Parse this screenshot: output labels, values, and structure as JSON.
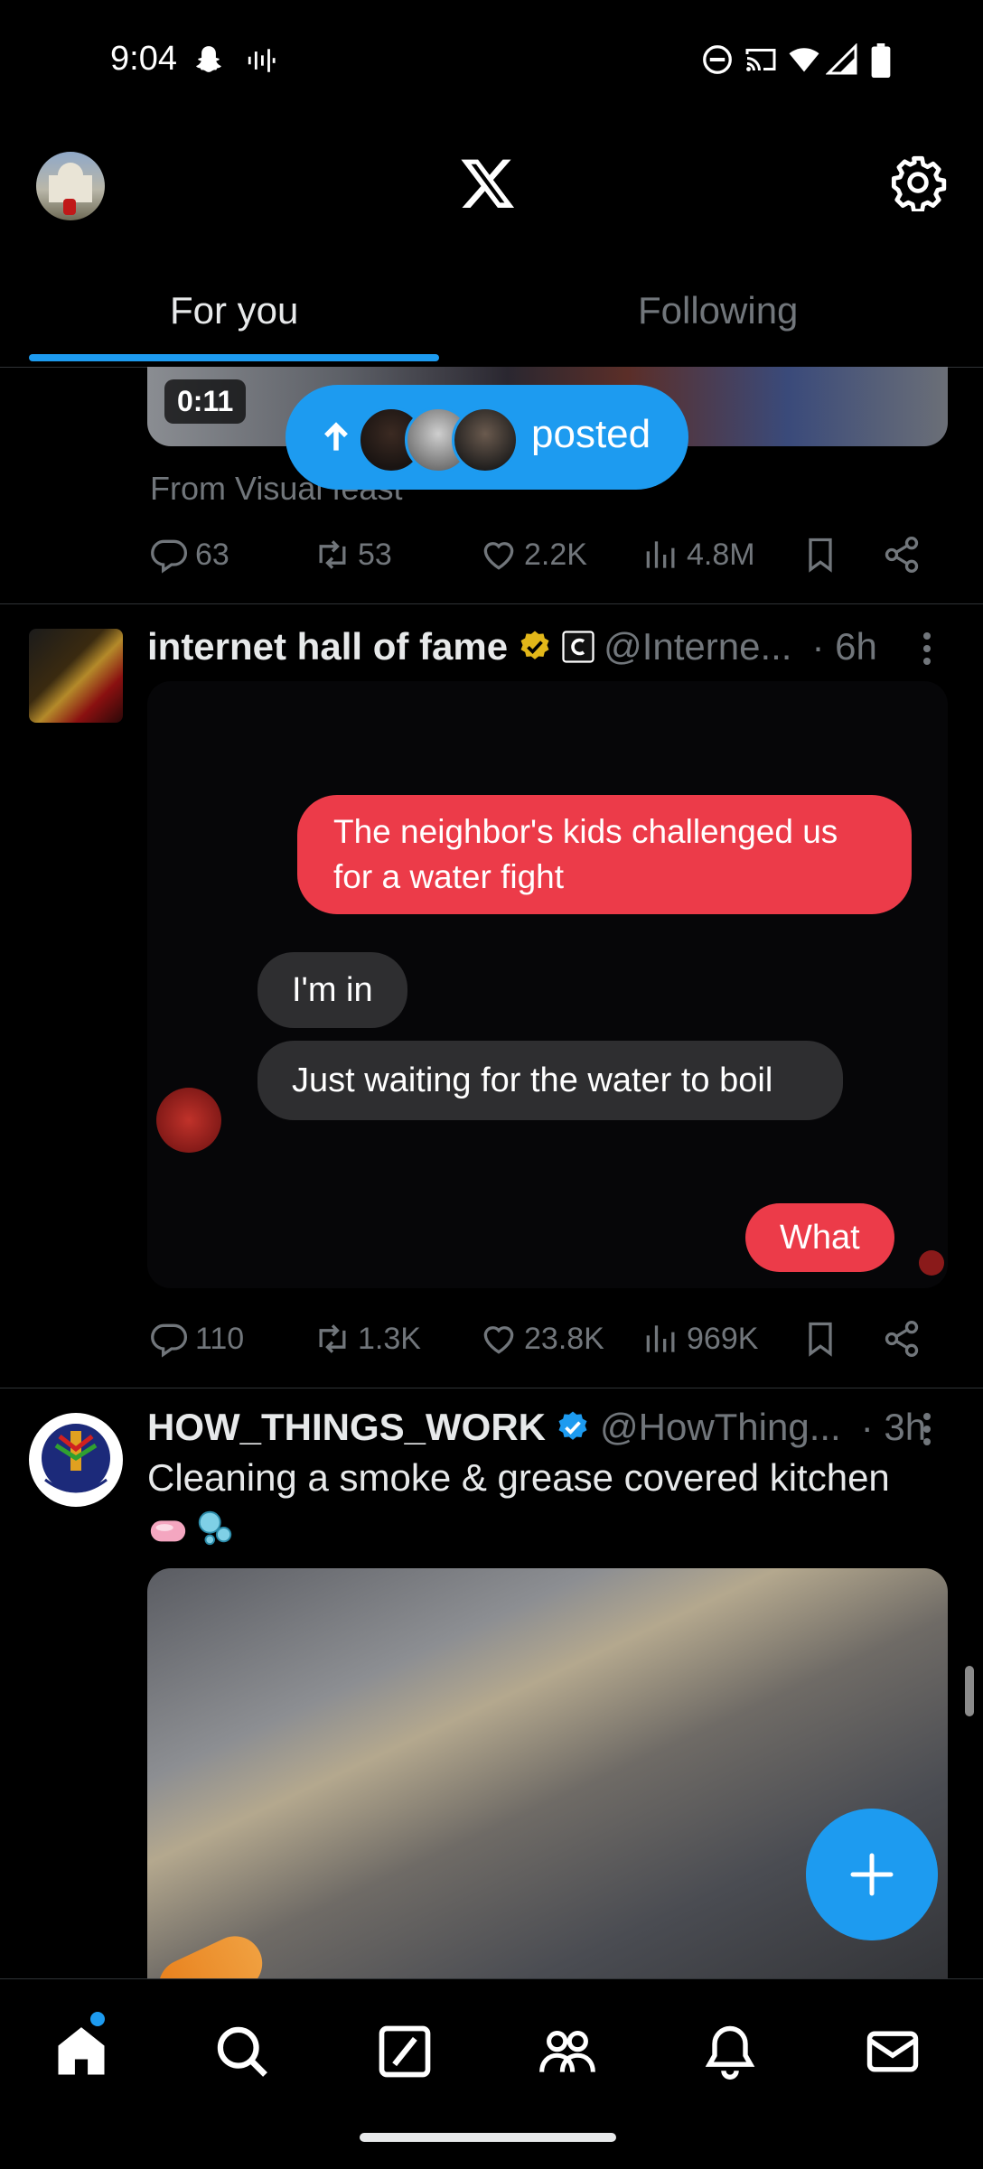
{
  "status_bar": {
    "time": "9:04",
    "left_icons": [
      "snapchat-icon",
      "voice-wave-icon"
    ],
    "right_icons": [
      "do-not-disturb-icon",
      "cast-icon",
      "wifi-icon",
      "signal-icon",
      "battery-icon"
    ]
  },
  "header": {
    "logo": "x-logo-icon",
    "settings_icon": "gear-icon"
  },
  "tabs": [
    {
      "label": "For you",
      "selected": true
    },
    {
      "label": "Following",
      "selected": false
    }
  ],
  "new_posts_pill": {
    "label": "posted",
    "icon": "arrow-up-icon"
  },
  "posts": [
    {
      "video_duration": "0:11",
      "from_line": "From Visual feast",
      "stats": {
        "replies": "63",
        "reposts": "53",
        "likes": "2.2K",
        "views": "4.8M"
      }
    },
    {
      "name": "internet hall of fame",
      "verified": "gold",
      "handle": "@Interne...",
      "time": "· 6h",
      "chat": [
        {
          "from": "them",
          "text": "The neighbor's kids challenged us for a water fight"
        },
        {
          "from": "me",
          "text": "I'm in"
        },
        {
          "from": "me",
          "text": "Just waiting for the water to boil"
        },
        {
          "from": "them",
          "text": "What"
        }
      ],
      "stats": {
        "replies": "110",
        "reposts": "1.3K",
        "likes": "23.8K",
        "views": "969K"
      }
    },
    {
      "name": "HOW_THINGS_WORK",
      "verified": "blue",
      "handle": "@HowThing...",
      "time": "· 3h",
      "text": "Cleaning a smoke & grease covered kitchen",
      "emoji": [
        "soap-icon",
        "bubbles-icon"
      ]
    }
  ],
  "fab_icon": "plus-icon",
  "bottom_nav": [
    {
      "icon": "home-icon",
      "active": true,
      "badge": true
    },
    {
      "icon": "search-icon"
    },
    {
      "icon": "grok-icon"
    },
    {
      "icon": "communities-icon"
    },
    {
      "icon": "bell-icon"
    },
    {
      "icon": "mail-icon"
    }
  ],
  "colors": {
    "accent": "#1d9bf0",
    "background": "#000000",
    "text": "#e7e9ea",
    "muted": "#71767b",
    "divider": "#2f3336",
    "chat_red": "#ec3b49",
    "chat_gray": "#2e2e30"
  }
}
